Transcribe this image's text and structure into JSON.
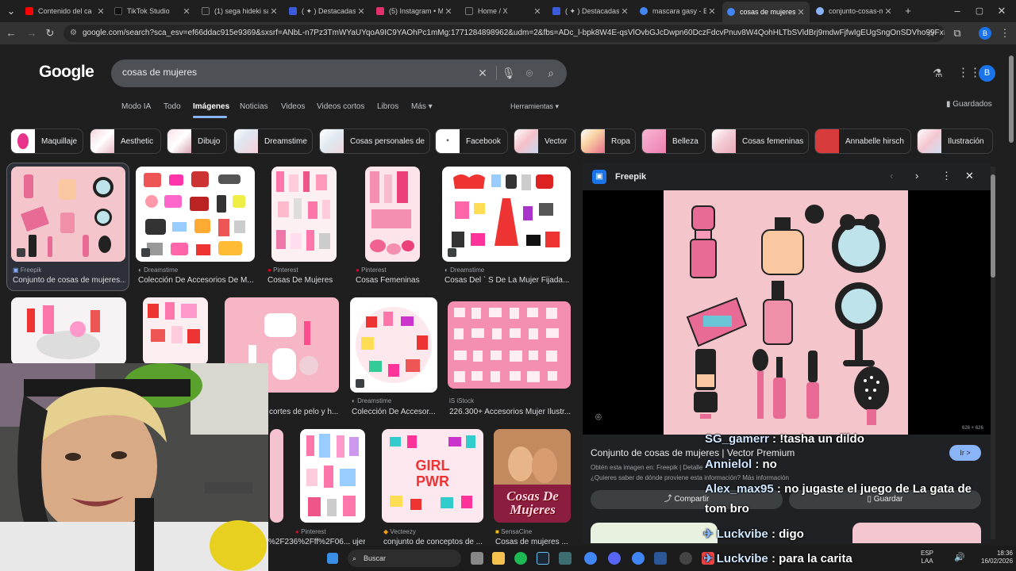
{
  "tabs": [
    {
      "label": "Contenido del ca",
      "fav": "#ff0000"
    },
    {
      "label": "TikTok Studio",
      "fav": "#111111"
    },
    {
      "label": "(1) sega hideki sa",
      "fav": "#222222"
    },
    {
      "label": "( ✦ ) Destacadas",
      "fav": "#3b5bdb"
    },
    {
      "label": "(5) Instagram • M",
      "fav": "#e1306c"
    },
    {
      "label": "Home / X",
      "fav": "#222222"
    },
    {
      "label": "( ✦ ) Destacadas",
      "fav": "#3b5bdb"
    },
    {
      "label": "mascara gasy - Bu",
      "fav": "#4285f4"
    },
    {
      "label": "cosas de mujeres",
      "fav": "#4285f4"
    },
    {
      "label": "conjunto-cosas-m",
      "fav": "#8ab4f8"
    }
  ],
  "url": "google.com/search?sca_esv=ef66ddac915e9369&sxsrf=ANbL-n7Pz3TmWYaUYqoA9IC9YAOhPc1mMg:1771284898962&udm=2&fbs=ADc_l-bpk8W4E-qsVlOvbGJcDwpn60DczFdcvPnuv8W4QohHLTbSVldBrj9mdwFjfwIgEUgSngOnSDVho99FxfCho2PSKWFrG-...",
  "google_logo": "Google",
  "search": {
    "value": "cosas de mujeres"
  },
  "account_initial": "B",
  "nav": [
    "Modo IA",
    "Todo",
    "Imágenes",
    "Noticias",
    "Videos",
    "Videos cortos",
    "Libros",
    "Más ▾"
  ],
  "tools_label": "Herramientas ▾",
  "saved_label": "Guardados",
  "chips": [
    "Maquillaje",
    "Aesthetic",
    "Dibujo",
    "Dreamstime",
    "Cosas personales de",
    "Facebook",
    "Vector",
    "Ropa",
    "Belleza",
    "Cosas femeninas",
    "Annabelle hirsch",
    "Ilustración"
  ],
  "results": [
    {
      "source": "Freepik",
      "title": "Conjunto de cosas de mujeres..."
    },
    {
      "source": "Dreamstime",
      "title": "Colección De Accesorios De M..."
    },
    {
      "source": "Pinterest",
      "title": "Cosas De Mujeres"
    },
    {
      "source": "Pinterest",
      "title": "Cosas Femeninas"
    },
    {
      "source": "Dreamstime",
      "title": "Cosas Del ` S De La Mujer Fijada..."
    },
    {
      "source": "",
      "title": "cortes de pelo y h..."
    },
    {
      "source": "Dreamstime",
      "title": "Colección De Accesor..."
    },
    {
      "source": "iStock",
      "title": "226.300+ Accesorios Mujer Ilustr..."
    },
    {
      "source": "Pinterest",
      "title": "ujeres ..."
    },
    {
      "source": "Vecteezy",
      "title": "conjunto de conceptos de ..."
    },
    {
      "source": "SensaCine",
      "title": "Cosas de mujeres ..."
    }
  ],
  "tile_text": {
    "girl": "GIRL",
    "pwr": "PWR",
    "poster": "Cosas De Mujeres",
    "url_frag": "%2F236%2Fff%2F06..."
  },
  "panel": {
    "source": "Freepik",
    "dimensions": "626 × 626",
    "title": "Conjunto de cosas de mujeres | Vector Premium",
    "obtained": "Obtén esta imagen en: Freepik | Detalle",
    "question": "¿Quieres saber de dónde proviene esta información? Más información",
    "visit": "Ir >",
    "share": "Compartir",
    "save": "Guardar"
  },
  "chat": [
    {
      "user": "SG_gamerr",
      "msg": ": !tasha un dildo"
    },
    {
      "user": "Annielol",
      "msg": ": no"
    },
    {
      "user": "Alex_max95",
      "msg": ": no jugaste el juego de La gata de"
    },
    {
      "user": "",
      "msg": "tom bro"
    },
    {
      "user": "Luckvibe",
      "msg": ": digo"
    },
    {
      "user": "Luckvibe",
      "msg": ": para la carita"
    }
  ],
  "taskbar": {
    "search": "Buscar",
    "lang1": "ESP",
    "lang2": "LAA",
    "time": "18:36",
    "date": "16/02/2026"
  },
  "colors": {
    "accent": "#8ab4f8",
    "pink_bg": "#f4c6cc",
    "panel_bg": "#202124"
  }
}
